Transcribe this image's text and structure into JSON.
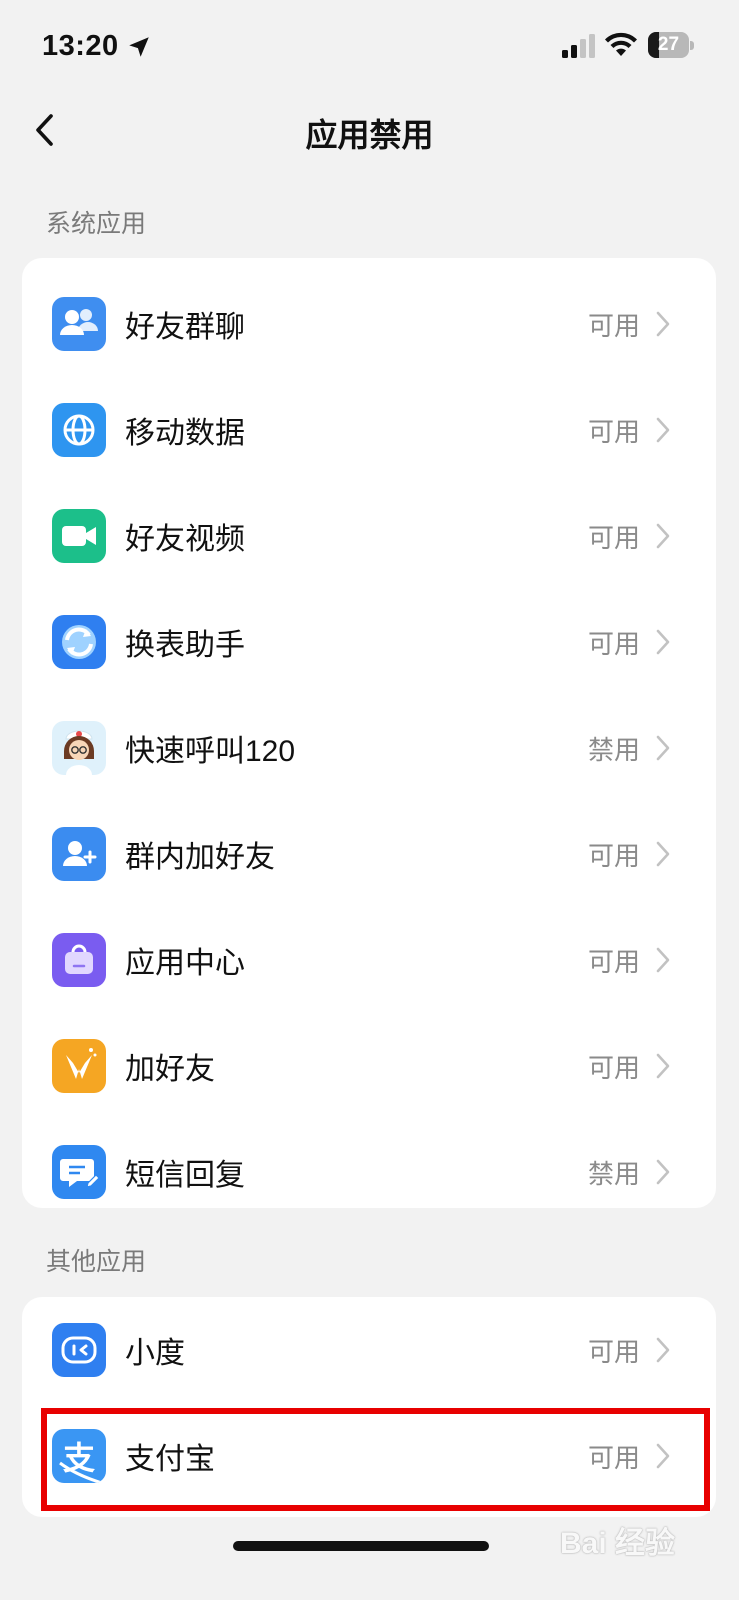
{
  "status_bar": {
    "time": "13:20",
    "battery_level": "27",
    "location_icon": "location-arrow-icon",
    "signal_icon": "cellular-signal-icon",
    "wifi_icon": "wifi-icon"
  },
  "nav": {
    "title": "应用禁用",
    "back_icon": "chevron-left-icon"
  },
  "sections": [
    {
      "title": "系统应用",
      "items": [
        {
          "label": "好友群聊",
          "status": "可用",
          "icon": "group-chat-icon",
          "color": "#3f8ef0"
        },
        {
          "label": "移动数据",
          "status": "可用",
          "icon": "globe-icon",
          "color": "#2e95f0"
        },
        {
          "label": "好友视频",
          "status": "可用",
          "icon": "video-camera-icon",
          "color": "#1cbf8a"
        },
        {
          "label": "换表助手",
          "status": "可用",
          "icon": "sync-icon",
          "color": "#2f7ff0"
        },
        {
          "label": "快速呼叫120",
          "status": "禁用",
          "icon": "nurse-icon",
          "color": "#dff1fb"
        },
        {
          "label": "群内加好友",
          "status": "可用",
          "icon": "add-user-icon",
          "color": "#3b8cf0"
        },
        {
          "label": "应用中心",
          "status": "可用",
          "icon": "shopping-bag-icon",
          "color": "#7a5cf0"
        },
        {
          "label": "加好友",
          "status": "可用",
          "icon": "handshake-icon",
          "color": "#f5a623"
        },
        {
          "label": "短信回复",
          "status": "禁用",
          "icon": "message-edit-icon",
          "color": "#2f88f0"
        }
      ]
    },
    {
      "title": "其他应用",
      "items": [
        {
          "label": "小度",
          "status": "可用",
          "icon": "xiaodu-icon",
          "color": "#2f7ff0"
        },
        {
          "label": "支付宝",
          "status": "可用",
          "icon": "alipay-icon",
          "color": "#3a96f3"
        }
      ]
    }
  ],
  "watermark": "Bai 经验"
}
